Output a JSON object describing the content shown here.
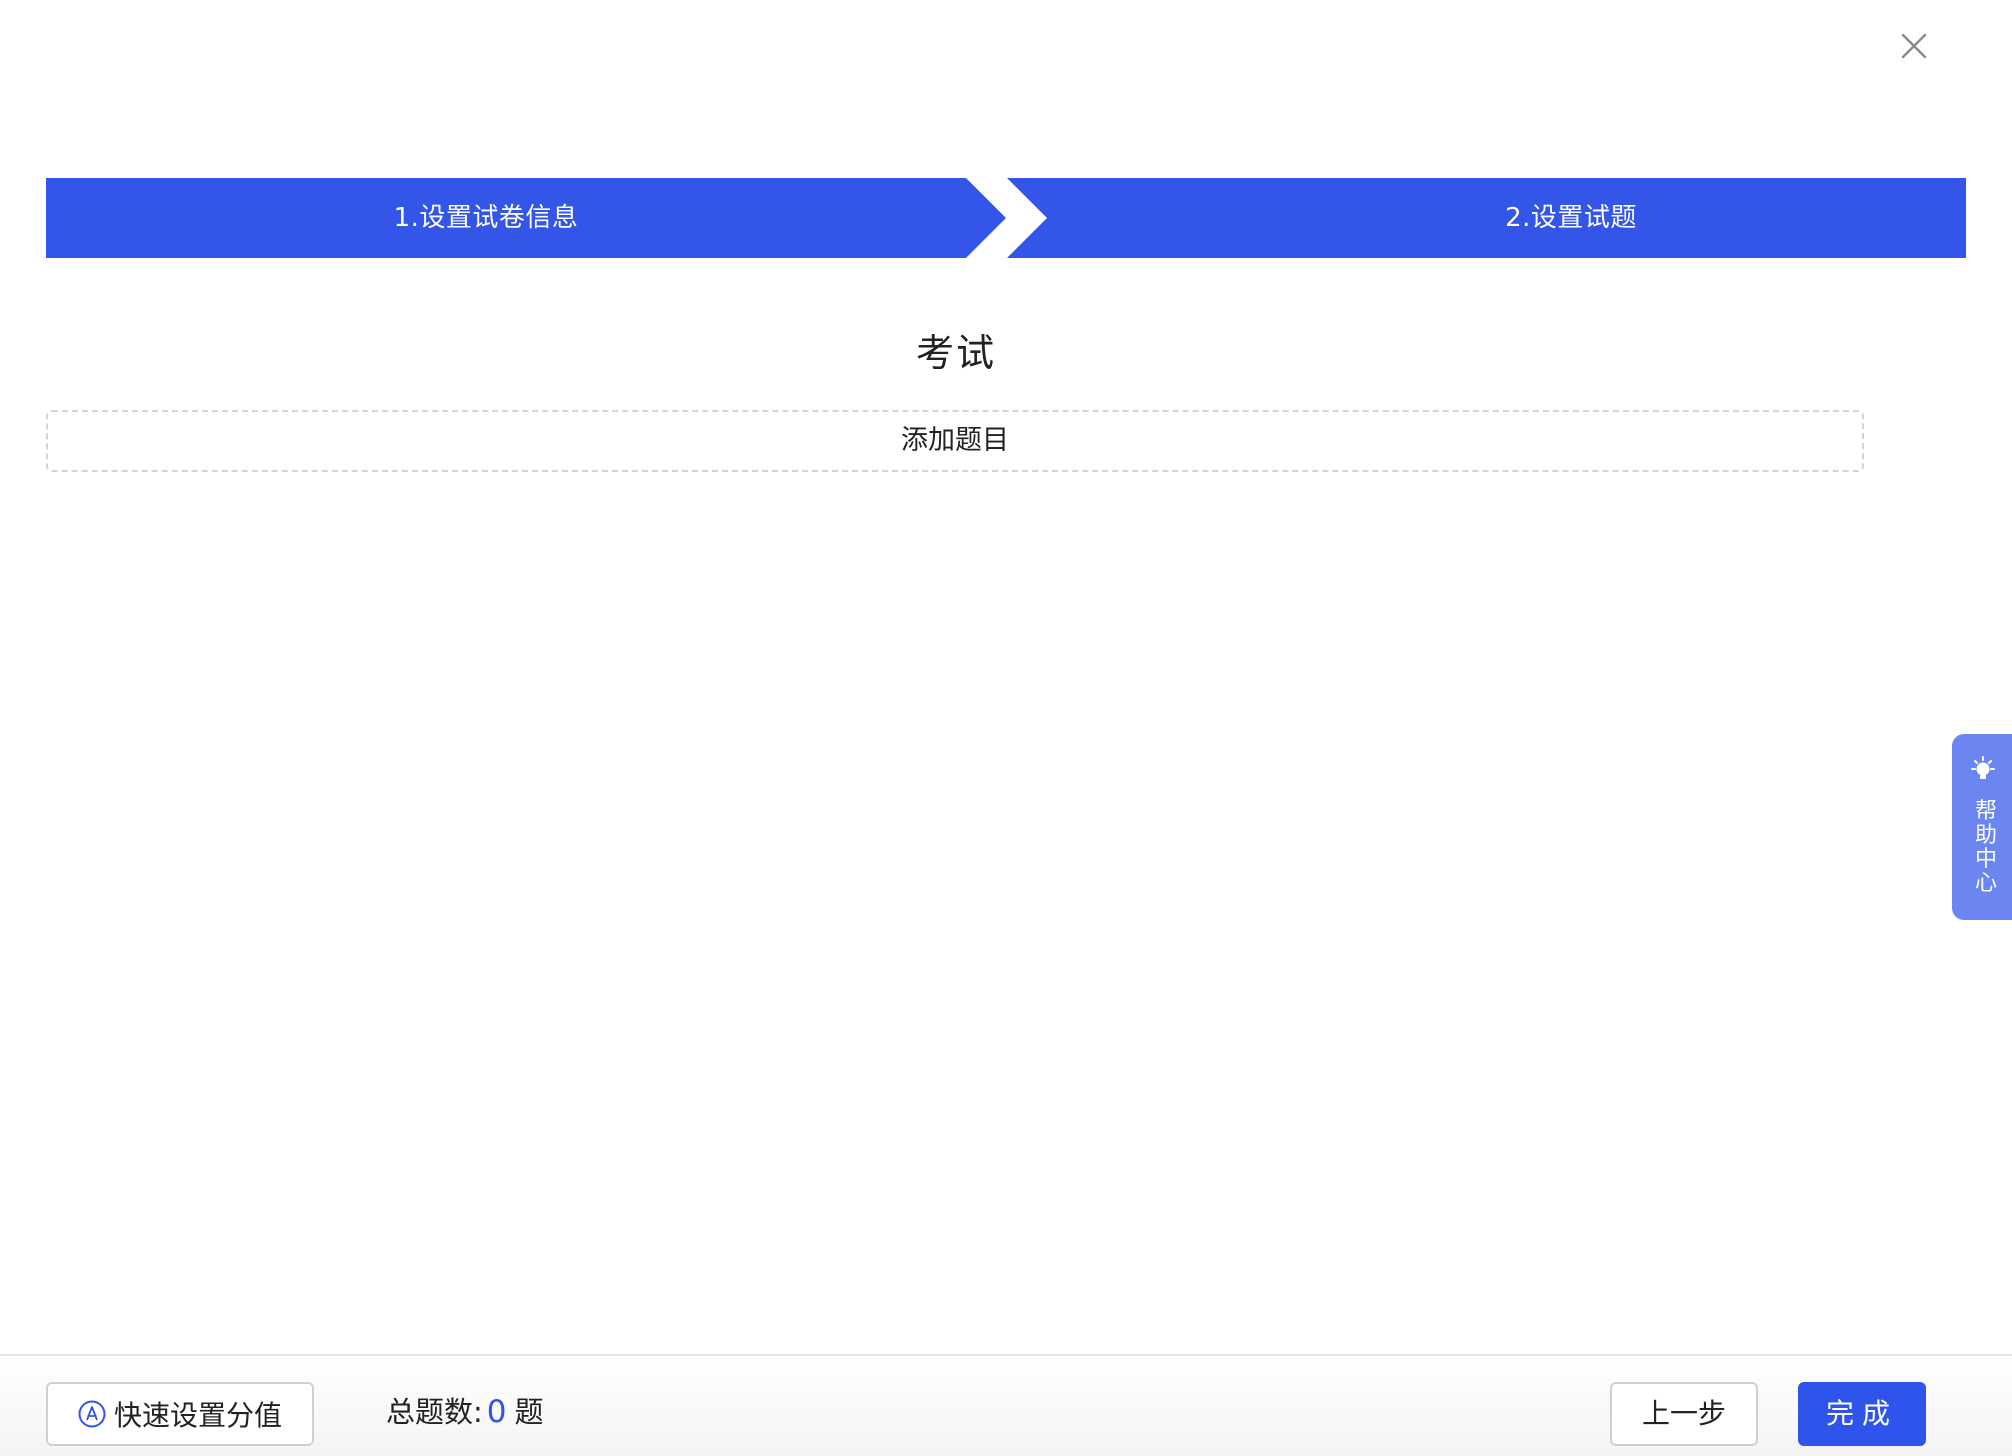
{
  "steps": [
    {
      "label": "1.设置试卷信息"
    },
    {
      "label": "2.设置试题"
    }
  ],
  "paper": {
    "title": "考试",
    "add_question_label": "添加题目"
  },
  "help": {
    "label": "帮助中心"
  },
  "footer": {
    "quick_score_label": "快速设置分值",
    "total_label": "总题数:",
    "total_count": "0",
    "total_unit": "题",
    "prev_label": "上一步",
    "done_label": "完成"
  },
  "colors": {
    "primary": "#2f54eb",
    "step_bar": "#3355e8",
    "help_tab": "#6b86f0",
    "dashed_border": "#d4d4d4"
  },
  "icons": {
    "close": "close-icon",
    "help": "lightbulb-icon",
    "quick_score": "circle-a-icon"
  }
}
